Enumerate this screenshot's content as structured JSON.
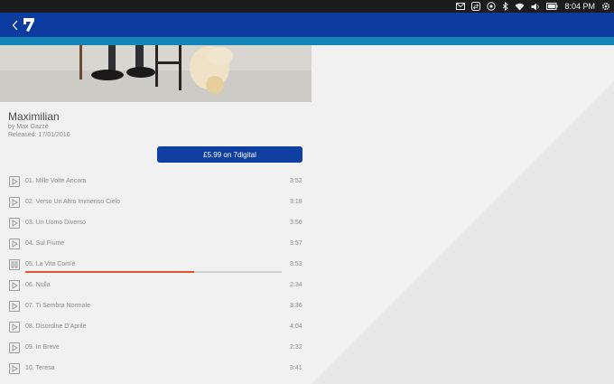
{
  "system": {
    "clock": "8:04 PM",
    "icons": [
      "mail-icon",
      "transfer-icon",
      "location-icon",
      "bluetooth-icon",
      "wifi-icon",
      "volume-icon",
      "battery-icon",
      "settings-icon"
    ]
  },
  "header": {
    "back_icon": "chevron-left-icon",
    "logo_icon": "7digital-logo-icon",
    "bar_color": "#0b3b9e",
    "stripe_color": "#1384b6"
  },
  "album": {
    "title": "Maximilian",
    "artist": "by Max Gazzè",
    "released": "Released: 17/01/2016",
    "buy_label": "£5.99 on 7digital"
  },
  "tracks": [
    {
      "name": "01. Mille Volte Ancora",
      "duration": "3:52",
      "state": "play"
    },
    {
      "name": "02. Verso Un Altro Immenso Cielo",
      "duration": "3:18",
      "state": "play"
    },
    {
      "name": "03. Un Uomo Diverso",
      "duration": "3:56",
      "state": "play"
    },
    {
      "name": "04. Sul Fiume",
      "duration": "3:57",
      "state": "play"
    },
    {
      "name": "05. La Vita Com'è",
      "duration": "3:53",
      "state": "pause",
      "progress": 0.66
    },
    {
      "name": "06. Nulla",
      "duration": "2:34",
      "state": "play"
    },
    {
      "name": "07. Ti Sembra Normale",
      "duration": "3:36",
      "state": "play"
    },
    {
      "name": "08. Disordine D'Aprile",
      "duration": "4:04",
      "state": "play"
    },
    {
      "name": "09. In Breve",
      "duration": "2:32",
      "state": "play"
    },
    {
      "name": "10. Teresa",
      "duration": "3:41",
      "state": "play"
    }
  ],
  "colors": {
    "accent": "#0f3fa0",
    "progress": "#d9572a"
  }
}
